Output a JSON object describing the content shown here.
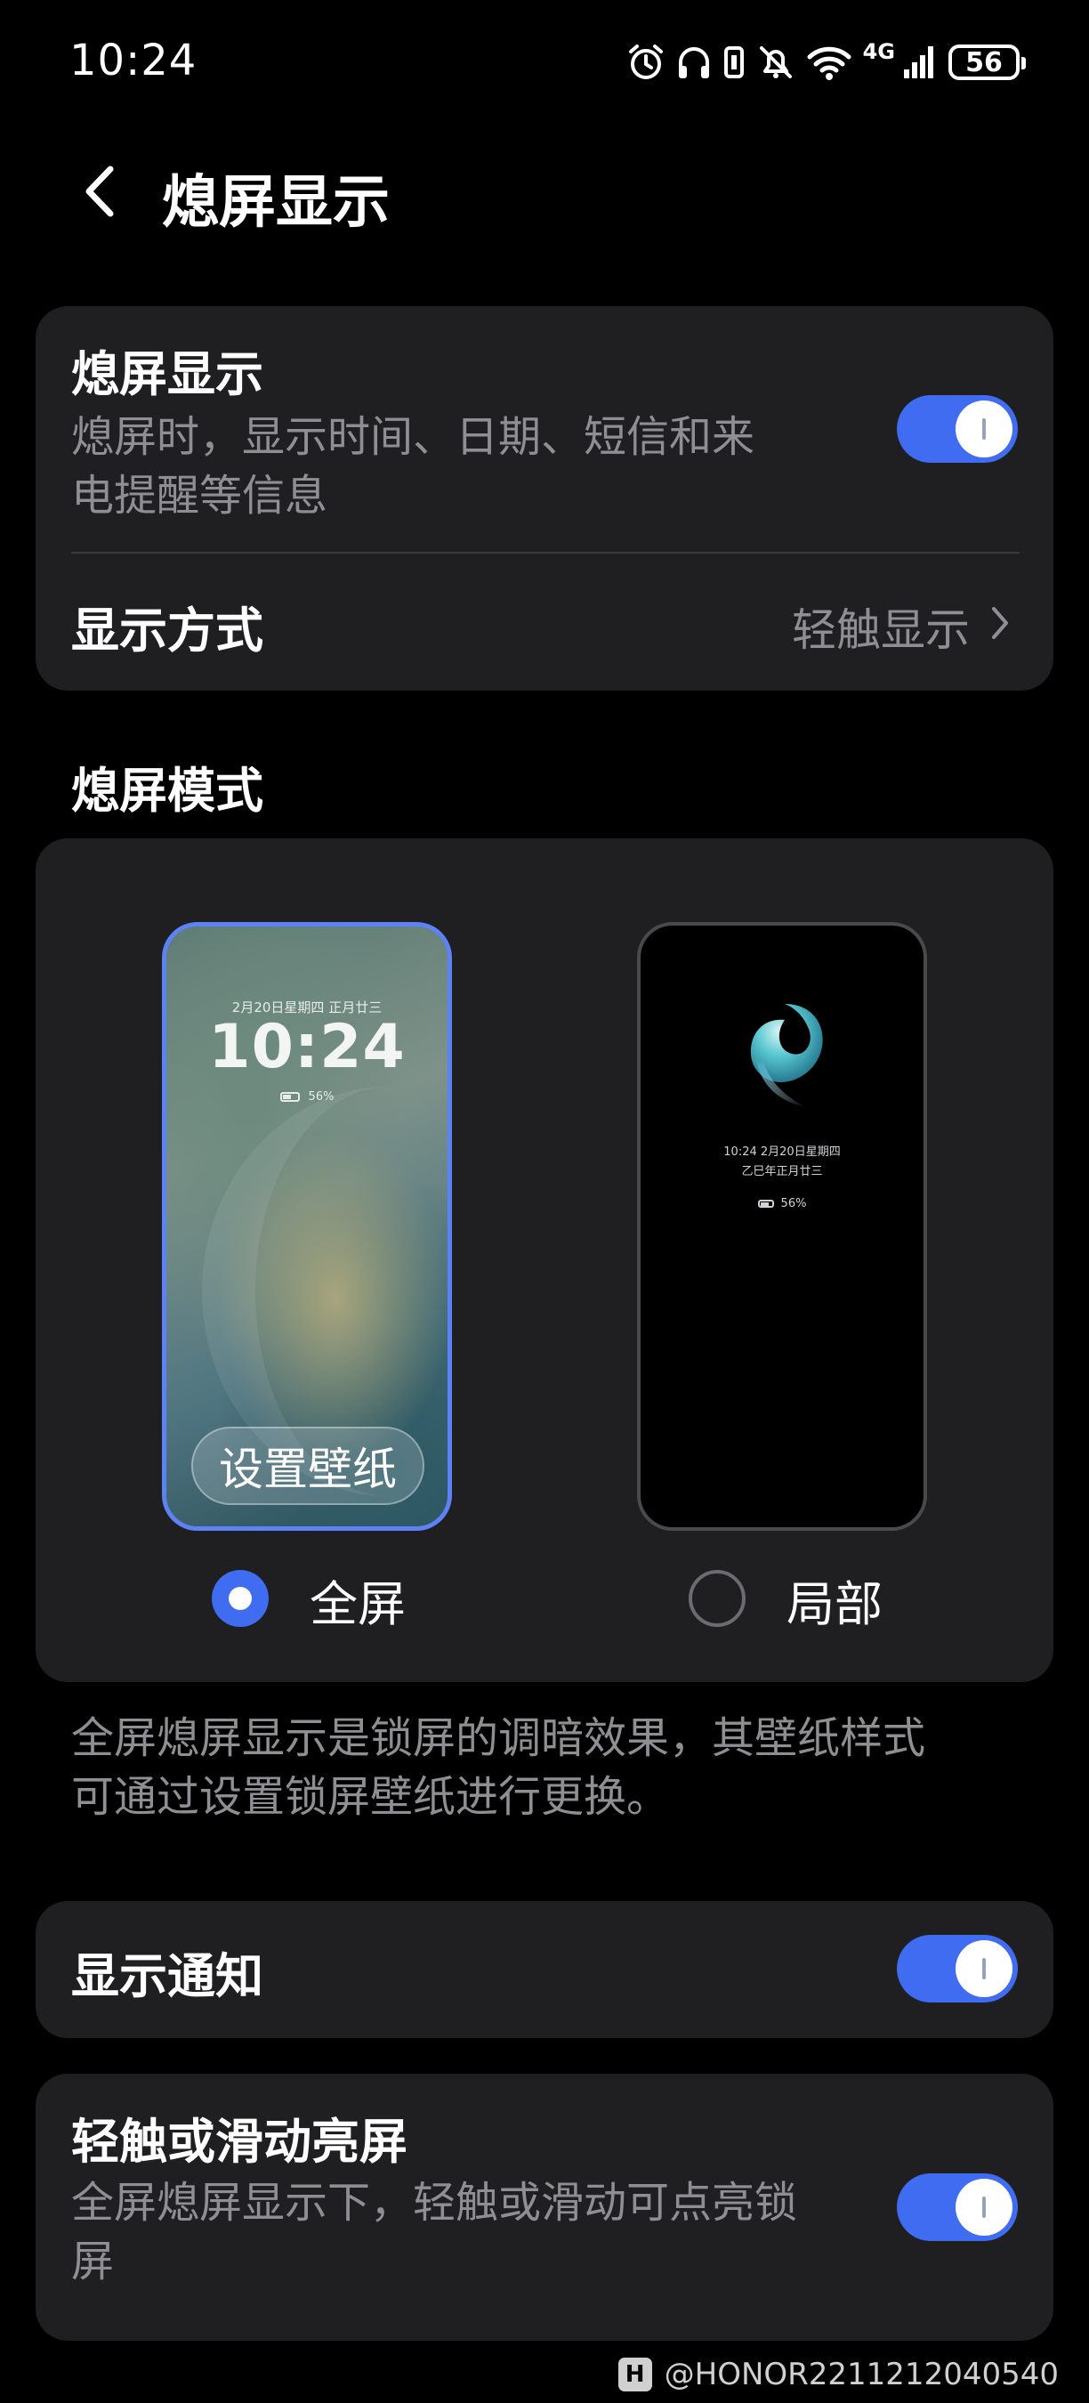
{
  "status_bar": {
    "time": "10:24",
    "network": "4G",
    "battery": "56"
  },
  "header": {
    "title": "熄屏显示"
  },
  "aod_card": {
    "title": "熄屏显示",
    "subtitle_line1": "熄屏时，显示时间、日期、短信和来",
    "subtitle_line2": "电提醒等信息",
    "enabled": true,
    "display_mode_label": "显示方式",
    "display_mode_value": "轻触显示"
  },
  "mode_section": {
    "title": "熄屏模式",
    "full": {
      "date": "2月20日星期四 正月廿三",
      "clock": "10:24",
      "battery": "56%",
      "button": "设置壁纸",
      "label": "全屏",
      "selected": true
    },
    "partial": {
      "line1": "10:24  2月20日星期四",
      "line2": "乙巳年正月廿三",
      "battery": "56%",
      "label": "局部",
      "selected": false
    }
  },
  "hint": {
    "line1": "全屏熄屏显示是锁屏的调暗效果，其壁纸样式",
    "line2": "可通过设置锁屏壁纸进行更换。"
  },
  "show_notifications": {
    "title": "显示通知",
    "enabled": true
  },
  "tap_wake": {
    "title": "轻触或滑动亮屏",
    "subtitle_line1": "全屏熄屏显示下，轻触或滑动可点亮锁",
    "subtitle_line2": "屏",
    "enabled": true
  },
  "watermark": {
    "text": "@HONOR2211212040540"
  },
  "colors": {
    "accent": "#3f6cf0",
    "card": "#1f1f21",
    "secondary_text": "#8f8f93"
  }
}
